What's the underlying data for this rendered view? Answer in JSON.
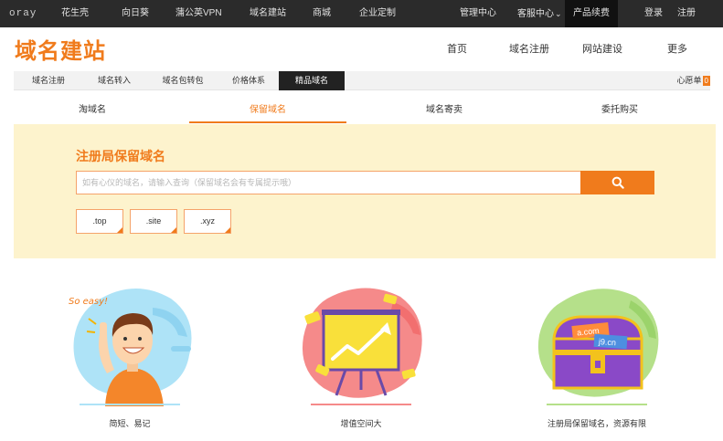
{
  "topbar": {
    "logo": "oray",
    "left_items": [
      "花生壳",
      "向日葵",
      "蒲公英VPN",
      "域名建站",
      "商城",
      "企业定制"
    ],
    "right_items": [
      "管理中心",
      "客服中心",
      "产品续费",
      "登录",
      "注册"
    ],
    "dropdown_arrow": "⌄"
  },
  "header": {
    "brand": "域名建站",
    "nav": [
      "首页",
      "域名注册",
      "网站建设",
      "更多"
    ]
  },
  "subnav": {
    "items": [
      "域名注册",
      "域名转入",
      "域名包转包",
      "价格体系",
      "精品域名"
    ],
    "active_index": 4,
    "cart_label": "心愿单",
    "cart_count": "0"
  },
  "tabs": {
    "items": [
      "淘域名",
      "保留域名",
      "域名寄卖",
      "委托购买"
    ],
    "active_index": 1
  },
  "search": {
    "title": "注册局保留域名",
    "placeholder": "如有心仪的域名，请输入查询（保留域名会有专属提示哦）",
    "button_icon": "search-icon",
    "tlds": [
      ".top",
      ".site",
      ".xyz"
    ]
  },
  "features": [
    {
      "caption": "简短、易记",
      "bubble_text": "So easy!",
      "icon": "happy-person-illustration"
    },
    {
      "caption": "增值空间大",
      "icon": "growth-chart-illustration"
    },
    {
      "caption": "注册局保留域名，资源有限",
      "tags": [
        "a.com",
        "j9.cn"
      ],
      "icon": "treasure-chest-illustration"
    }
  ],
  "colors": {
    "accent": "#f07b1c",
    "topbar_bg": "#2b2b2b",
    "panel_bg": "#fdf3cd"
  }
}
